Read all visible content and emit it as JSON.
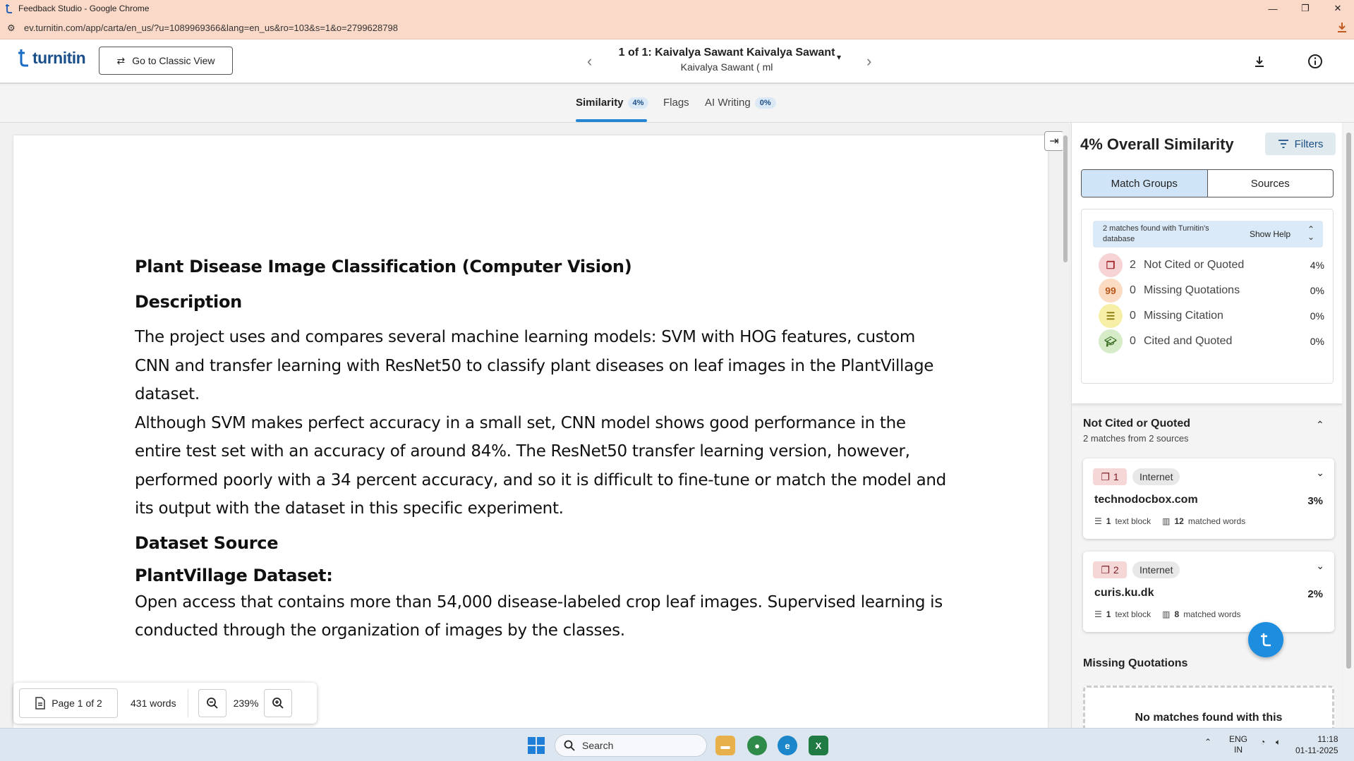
{
  "browser": {
    "window_title": "Feedback Studio - Google Chrome",
    "url": "ev.turnitin.com/app/carta/en_us/?u=1089969366&lang=en_us&ro=103&s=1&o=2799628798"
  },
  "header": {
    "logo_text": "turnitin",
    "classic_view_label": "Go to Classic View",
    "student_name": "1 of 1: Kaivalya Sawant Kaivalya Sawant",
    "student_sub": "Kaivalya Sawant ( ml"
  },
  "tabs": [
    {
      "label": "Similarity",
      "badge": "4%"
    },
    {
      "label": "Flags",
      "badge": ""
    },
    {
      "label": "AI Writing",
      "badge": "0%"
    }
  ],
  "document": {
    "title": "Plant Disease Image Classification (Computer Vision)",
    "desc_heading": "Description",
    "para1": "The project uses and compares several machine learning models: SVM with HOG features, custom CNN and transfer learning with ResNet50 to classify plant diseases on leaf images in the PlantVillage dataset.",
    "para2": "Although SVM makes perfect accuracy in a small set, CNN model shows good performance in the entire test set with an accuracy of around 84%. The ResNet50 transfer learning version, however, performed poorly with a 34 percent accuracy, and so it is difficult to fine-tune or match the model and its output with the dataset in this specific experiment.",
    "dataset_heading": "Dataset Source",
    "plantvillage_heading": "PlantVillage Dataset:",
    "para3": "Open access that contains more than 54,000 disease-labeled crop leaf images. Supervised learning is conducted through the organization of images by the classes."
  },
  "page_toolbar": {
    "page_label": "Page 1 of 2",
    "words": "431 words",
    "zoom": "239%"
  },
  "panel": {
    "overall": "4% Overall Similarity",
    "filters_label": "Filters",
    "seg_match_groups": "Match Groups",
    "seg_sources": "Sources",
    "help_text": "2 matches found with Turnitin's database",
    "show_help": "Show Help",
    "groups": [
      {
        "count": "2",
        "label": "Not Cited or Quoted",
        "pct": "4%",
        "color": "#f6d3d4"
      },
      {
        "count": "0",
        "label": "Missing Quotations",
        "pct": "0%",
        "color": "#fbdcc2"
      },
      {
        "count": "0",
        "label": "Missing Citation",
        "pct": "0%",
        "color": "#f7efa8"
      },
      {
        "count": "0",
        "label": "Cited and Quoted",
        "pct": "0%",
        "color": "#d6ecc8"
      }
    ],
    "nc_heading": "Not Cited or Quoted",
    "nc_sub": "2 matches from 2 sources",
    "sources": [
      {
        "num": "1",
        "type": "Internet",
        "domain": "technodocbox.com",
        "pct": "3%",
        "blocks": "1",
        "blocks_label": "text block",
        "words": "12",
        "words_label": "matched words"
      },
      {
        "num": "2",
        "type": "Internet",
        "domain": "curis.ku.dk",
        "pct": "2%",
        "blocks": "1",
        "blocks_label": "text block",
        "words": "8",
        "words_label": "matched words"
      }
    ],
    "mq_heading": "Missing Quotations",
    "mq_empty": "No matches found with this"
  },
  "taskbar": {
    "search_label": "Search",
    "lang": "ENG",
    "region": "IN",
    "time": "11:18",
    "date": "01-11-2025"
  }
}
